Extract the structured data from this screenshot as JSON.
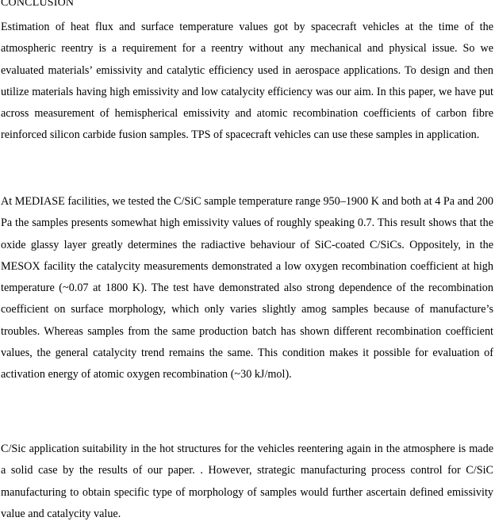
{
  "document": {
    "heading": "CONCLUSION",
    "paragraphs": [
      "Estimation of heat flux and surface temperature values got by spacecraft vehicles at the time of the atmospheric reentry is a requirement for a reentry without any mechanical and physical issue. So we evaluated materials’ emissivity and catalytic efficiency used in aerospace applications. To design and then utilize materials having high emissivity and low catalycity efficiency was our aim. In this paper, we have put across measurement of hemispherical emissivity and atomic recombination coefficients of carbon fibre reinforced silicon carbide fusion samples. TPS of spacecraft vehicles can use these samples in application.",
      "At MEDIASE facilities, we tested the C/SiC sample temperature range 950–1900 K and both at 4 Pa and 200 Pa the samples presents somewhat high emissivity values of roughly speaking 0.7. This result shows that the oxide glassy layer greatly determines the radiactive behaviour of SiC-coated C/SiCs. Oppositely, in the MESOX facility the catalycity measurements demonstrated a low oxygen recombination coefficient at high temperature (~0.07 at 1800 K). The test have demonstrated also strong dependence of the recombination coefficient on surface morphology, which only varies slightly amog samples because of manufacture’s troubles. Whereas samples from the same production batch has shown different recombination coefficient values, the general catalycity trend remains the same. This condition makes it possible for evaluation of activation energy of atomic oxygen recombination (~30 kJ/mol).",
      "C/Sic application suitability in the hot structures for the vehicles reentering again in the atmosphere is made a solid case by the results of our paper. . However, strategic manufacturing process control for C/SiC manufacturing to obtain specific type of morphology of samples would further ascertain defined emissivity value and catalycity value."
    ]
  }
}
